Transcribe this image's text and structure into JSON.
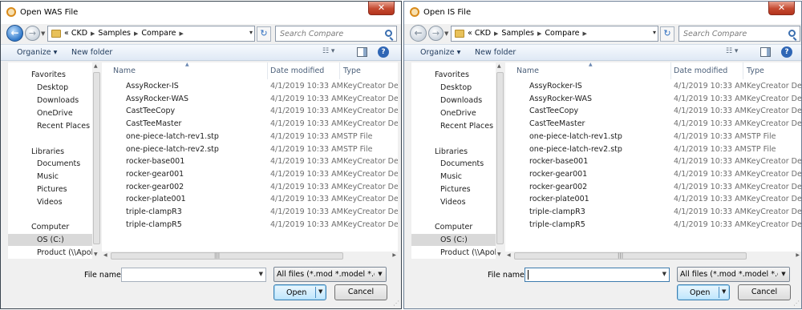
{
  "dialogs": [
    {
      "title": "Open WAS File",
      "breadcrumb": [
        "CKD",
        "Samples",
        "Compare"
      ],
      "search_placeholder": "Search Compare",
      "toolbar": {
        "organize": "Organize ▾",
        "new_folder": "New folder"
      },
      "nav": {
        "favorites": "Favorites",
        "favorite_items": [
          "Desktop",
          "Downloads",
          "OneDrive",
          "Recent Places"
        ],
        "libraries": "Libraries",
        "library_items": [
          "Documents",
          "Music",
          "Pictures",
          "Videos"
        ],
        "computer": "Computer",
        "computer_items": [
          "OS (C:)",
          "Product (\\\\Apollo"
        ]
      },
      "columns": {
        "name": "Name",
        "date": "Date modified",
        "type": "Type"
      },
      "files": [
        {
          "name": "AssyRocker-IS",
          "date": "4/1/2019 10:33 AM",
          "type": "KeyCreator Design"
        },
        {
          "name": "AssyRocker-WAS",
          "date": "4/1/2019 10:33 AM",
          "type": "KeyCreator Design"
        },
        {
          "name": "CastTeeCopy",
          "date": "4/1/2019 10:33 AM",
          "type": "KeyCreator Design"
        },
        {
          "name": "CastTeeMaster",
          "date": "4/1/2019 10:33 AM",
          "type": "KeyCreator Design"
        },
        {
          "name": "one-piece-latch-rev1.stp",
          "date": "4/1/2019 10:33 AM",
          "type": "STP File"
        },
        {
          "name": "one-piece-latch-rev2.stp",
          "date": "4/1/2019 10:33 AM",
          "type": "STP File"
        },
        {
          "name": "rocker-base001",
          "date": "4/1/2019 10:33 AM",
          "type": "KeyCreator Design"
        },
        {
          "name": "rocker-gear001",
          "date": "4/1/2019 10:33 AM",
          "type": "KeyCreator Design"
        },
        {
          "name": "rocker-gear002",
          "date": "4/1/2019 10:33 AM",
          "type": "KeyCreator Design"
        },
        {
          "name": "rocker-plate001",
          "date": "4/1/2019 10:33 AM",
          "type": "KeyCreator Design"
        },
        {
          "name": "triple-clampR3",
          "date": "4/1/2019 10:33 AM",
          "type": "KeyCreator Design"
        },
        {
          "name": "triple-clampR5",
          "date": "4/1/2019 10:33 AM",
          "type": "KeyCreator Design"
        }
      ],
      "filename_label": "File name:",
      "filename_value": "",
      "filter": "All files (*.mod *.model *.dlv *.ckd",
      "open": "Open",
      "cancel": "Cancel"
    },
    {
      "title": "Open IS File",
      "breadcrumb": [
        "CKD",
        "Samples",
        "Compare"
      ],
      "search_placeholder": "Search Compare",
      "toolbar": {
        "organize": "Organize ▾",
        "new_folder": "New folder"
      },
      "nav": {
        "favorites": "Favorites",
        "favorite_items": [
          "Desktop",
          "Downloads",
          "OneDrive",
          "Recent Places"
        ],
        "libraries": "Libraries",
        "library_items": [
          "Documents",
          "Music",
          "Pictures",
          "Videos"
        ],
        "computer": "Computer",
        "computer_items": [
          "OS (C:)",
          "Product (\\\\Apollo"
        ]
      },
      "columns": {
        "name": "Name",
        "date": "Date modified",
        "type": "Type"
      },
      "files": [
        {
          "name": "AssyRocker-IS",
          "date": "4/1/2019 10:33 AM",
          "type": "KeyCreator Design"
        },
        {
          "name": "AssyRocker-WAS",
          "date": "4/1/2019 10:33 AM",
          "type": "KeyCreator Design"
        },
        {
          "name": "CastTeeCopy",
          "date": "4/1/2019 10:33 AM",
          "type": "KeyCreator Design"
        },
        {
          "name": "CastTeeMaster",
          "date": "4/1/2019 10:33 AM",
          "type": "KeyCreator Design"
        },
        {
          "name": "one-piece-latch-rev1.stp",
          "date": "4/1/2019 10:33 AM",
          "type": "STP File"
        },
        {
          "name": "one-piece-latch-rev2.stp",
          "date": "4/1/2019 10:33 AM",
          "type": "STP File"
        },
        {
          "name": "rocker-base001",
          "date": "4/1/2019 10:33 AM",
          "type": "KeyCreator Design"
        },
        {
          "name": "rocker-gear001",
          "date": "4/1/2019 10:33 AM",
          "type": "KeyCreator Design"
        },
        {
          "name": "rocker-gear002",
          "date": "4/1/2019 10:33 AM",
          "type": "KeyCreator Design"
        },
        {
          "name": "rocker-plate001",
          "date": "4/1/2019 10:33 AM",
          "type": "KeyCreator Design"
        },
        {
          "name": "triple-clampR3",
          "date": "4/1/2019 10:33 AM",
          "type": "KeyCreator Design"
        },
        {
          "name": "triple-clampR5",
          "date": "4/1/2019 10:33 AM",
          "type": "KeyCreator Design"
        }
      ],
      "filename_label": "File name:",
      "filename_value": "",
      "filter": "All files (*.mod *.model *.dlv *.ckd",
      "open": "Open",
      "cancel": "Cancel"
    }
  ]
}
